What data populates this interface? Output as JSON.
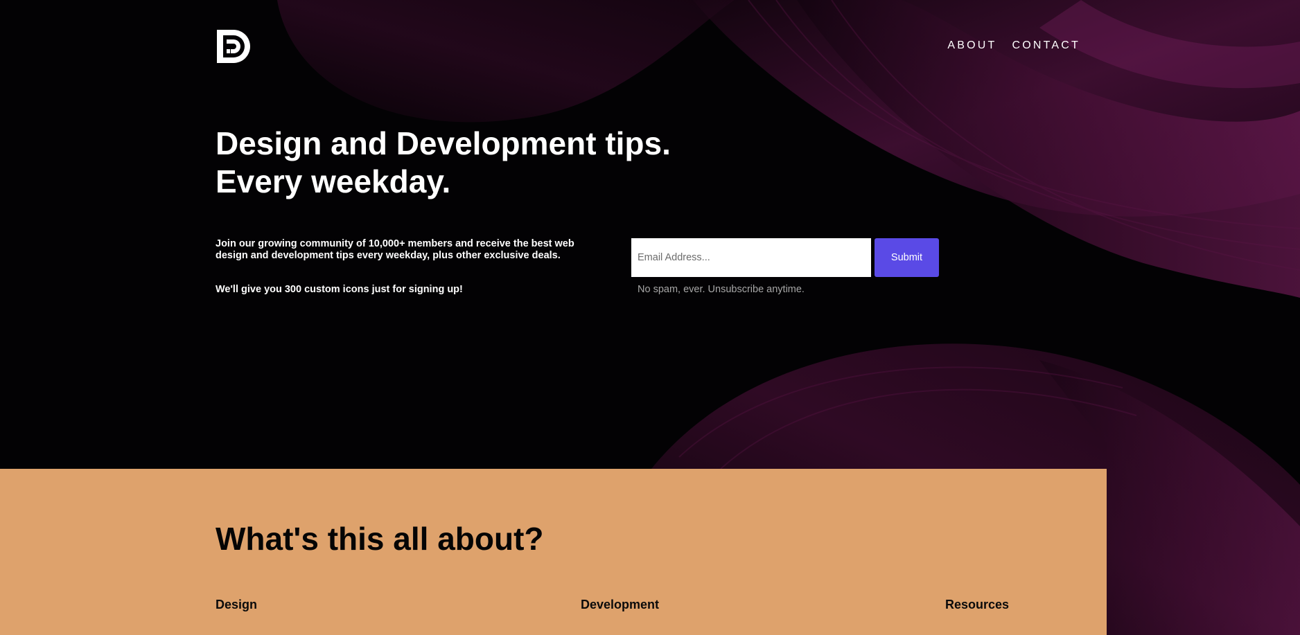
{
  "colors": {
    "page_background": "#030204",
    "accent_purple": "#5a4ae6",
    "about_background": "#dea26c",
    "swirl_color": "#5a1446"
  },
  "header": {
    "logo_icon": "dd-logo-icon",
    "nav": {
      "about_label": "ABOUT",
      "contact_label": "CONTACT"
    }
  },
  "hero": {
    "title_line1": "Design and Development tips.",
    "title_line2": "Every weekday.",
    "description": "Join our growing community of 10,000+ members and receive the best web design and development tips every weekday, plus other exclusive deals.",
    "offer": "We'll give you 300 custom icons just for signing up!",
    "signup": {
      "email_placeholder": "Email Address...",
      "email_value": "",
      "submit_label": "Submit",
      "disclaimer": "No spam, ever. Unsubscribe anytime."
    }
  },
  "about": {
    "title": "What's this all about?",
    "columns": [
      "Design",
      "Development",
      "Resources"
    ]
  }
}
